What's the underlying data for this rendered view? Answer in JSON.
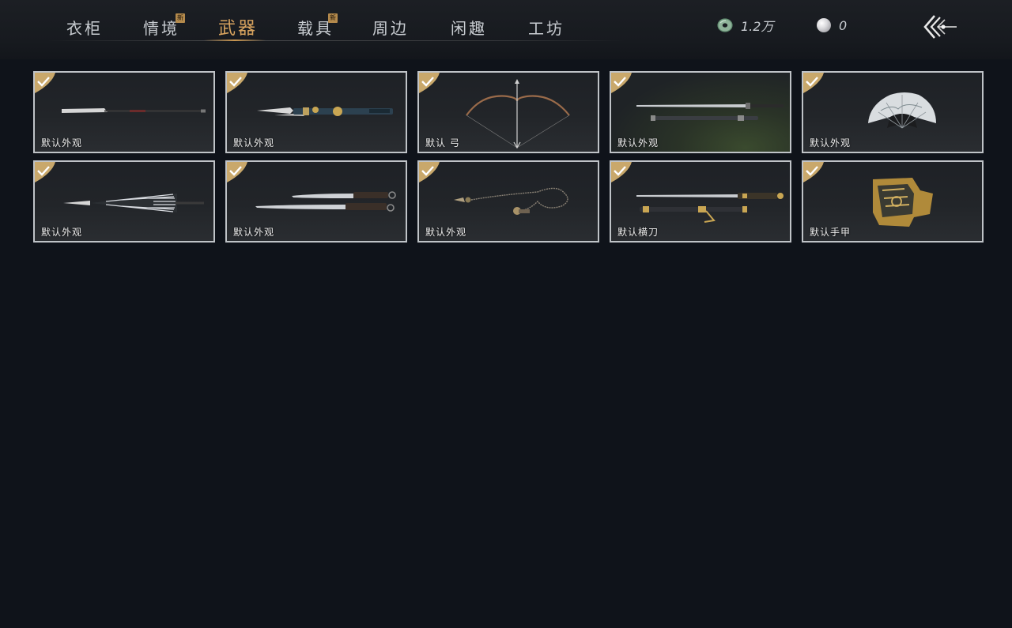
{
  "tabs": [
    {
      "label": "衣柜",
      "new": false,
      "active": false
    },
    {
      "label": "情境",
      "new": true,
      "active": false
    },
    {
      "label": "武器",
      "new": false,
      "active": true
    },
    {
      "label": "载具",
      "new": true,
      "active": false
    },
    {
      "label": "周边",
      "new": false,
      "active": false
    },
    {
      "label": "闲趣",
      "new": false,
      "active": false
    },
    {
      "label": "工坊",
      "new": false,
      "active": false
    }
  ],
  "new_badge": "新",
  "currency": {
    "jade": {
      "icon": "jade-coin-icon",
      "value": "1.2万"
    },
    "pearl": {
      "icon": "pearl-icon",
      "value": "0"
    }
  },
  "back_icon": "back-arrow-icon",
  "items": [
    {
      "name": "默认外观",
      "icon": "long-blade-icon",
      "owned": true
    },
    {
      "name": "默认外观",
      "icon": "twin-blade-staff-icon",
      "owned": true
    },
    {
      "name": "默认 弓",
      "icon": "bow-icon",
      "owned": true
    },
    {
      "name": "默认外观",
      "icon": "sword-and-scabbard-icon",
      "owned": true
    },
    {
      "name": "默认外观",
      "icon": "folding-fan-icon",
      "owned": true
    },
    {
      "name": "默认外观",
      "icon": "umbrella-spear-icon",
      "owned": true
    },
    {
      "name": "默认外观",
      "icon": "twin-dao-icon",
      "owned": true
    },
    {
      "name": "默认外观",
      "icon": "rope-dart-icon",
      "owned": true
    },
    {
      "name": "默认横刀",
      "icon": "hengdao-icon",
      "owned": true
    },
    {
      "name": "默认手甲",
      "icon": "gauntlet-icon",
      "owned": true
    }
  ],
  "colors": {
    "accent": "#d9a45f",
    "badge": "#b48a4c",
    "check": "#c9a86b",
    "card_border": "#bfc3c7"
  }
}
